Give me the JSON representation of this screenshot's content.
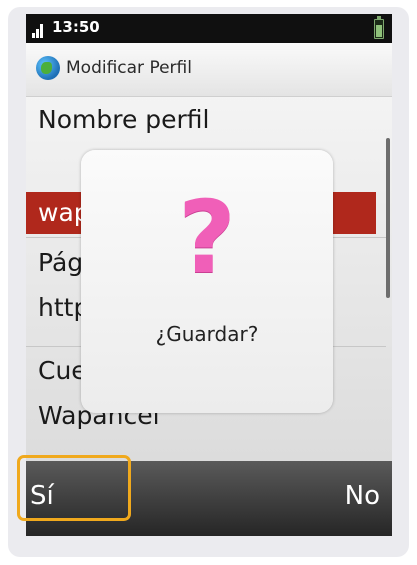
{
  "status_bar": {
    "time": "13:50"
  },
  "header": {
    "title": "Modificar Perfil"
  },
  "form": {
    "nombre_label": "Nombre perfil",
    "nombre_value": "wapancel",
    "pagina_label": "Página de inicio",
    "pagina_value": "http://",
    "cuenta_label": "Cuenta",
    "cuenta_value": "Wapancel"
  },
  "dialog": {
    "icon": "question-mark-icon",
    "icon_glyph": "?",
    "message": "¿Guardar?"
  },
  "softkeys": {
    "left": "Sí",
    "right": "No"
  },
  "colors": {
    "selected_row": "#b0281c",
    "question_mark": "#f05fb8",
    "highlight_box": "#f0a91d"
  }
}
